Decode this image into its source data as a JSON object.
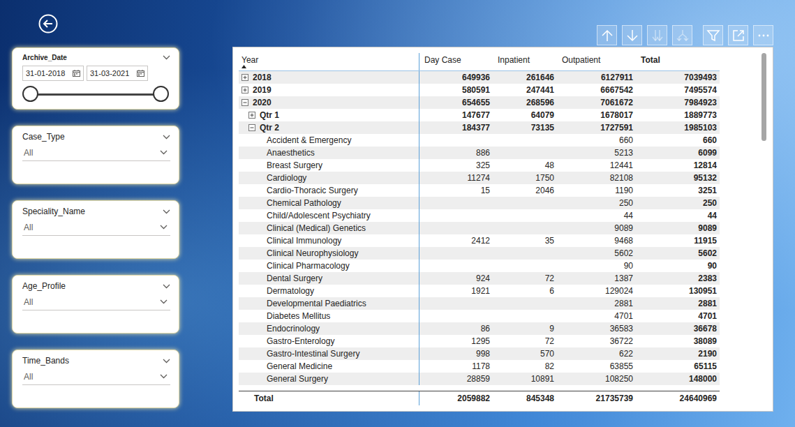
{
  "slicers": [
    {
      "kind": "date-range",
      "title": "Archive_Date",
      "start": "31-01-2018",
      "end": "31-03-2021",
      "low_level": 0,
      "high_level": 1
    },
    {
      "kind": "dropdown",
      "title": "Case_Type",
      "value": "All"
    },
    {
      "kind": "dropdown",
      "title": "Speciality_Name",
      "value": "All"
    },
    {
      "kind": "dropdown",
      "title": "Age_Profile",
      "value": "All"
    },
    {
      "kind": "dropdown",
      "title": "Time_Bands",
      "value": "All"
    }
  ],
  "toolbar": {
    "buttons": [
      {
        "kind": "drill-up",
        "disabled": false
      },
      {
        "kind": "drill-down",
        "disabled": false
      },
      {
        "kind": "next-level",
        "disabled": true
      },
      {
        "kind": "expand-all",
        "disabled": true
      },
      {
        "kind": "filter",
        "disabled": false
      },
      {
        "kind": "focus",
        "disabled": false
      },
      {
        "kind": "more",
        "disabled": false
      }
    ]
  },
  "table": {
    "columns": [
      {
        "label": "Year",
        "sorted": true,
        "bold": false
      },
      {
        "label": "Day Case",
        "sorted": false,
        "bold": false
      },
      {
        "label": "Inpatient",
        "sorted": false,
        "bold": false
      },
      {
        "label": "Outpatient",
        "sorted": false,
        "bold": false
      },
      {
        "label": "Total",
        "sorted": false,
        "bold": true
      }
    ],
    "rows": [
      {
        "kind": "year",
        "label": "2018",
        "expanded": false,
        "values": [
          "649936",
          "261646",
          "6127911",
          "7039493"
        ]
      },
      {
        "kind": "year",
        "label": "2019",
        "expanded": false,
        "values": [
          "580591",
          "247441",
          "6667542",
          "7495574"
        ]
      },
      {
        "kind": "year",
        "label": "2020",
        "expanded": true,
        "values": [
          "654655",
          "268596",
          "7061672",
          "7984923"
        ]
      },
      {
        "kind": "quarter",
        "label": "Qtr 1",
        "expanded": false,
        "values": [
          "147677",
          "64079",
          "1678017",
          "1889773"
        ]
      },
      {
        "kind": "quarter",
        "label": "Qtr 2",
        "expanded": true,
        "values": [
          "184377",
          "73135",
          "1727591",
          "1985103"
        ]
      },
      {
        "kind": "item",
        "label": "Accident & Emergency",
        "expanded": false,
        "values": [
          "",
          "",
          "660",
          "660"
        ]
      },
      {
        "kind": "item",
        "label": "Anaesthetics",
        "expanded": false,
        "values": [
          "886",
          "",
          "5213",
          "6099"
        ]
      },
      {
        "kind": "item",
        "label": "Breast Surgery",
        "expanded": false,
        "values": [
          "325",
          "48",
          "12441",
          "12814"
        ]
      },
      {
        "kind": "item",
        "label": "Cardiology",
        "expanded": false,
        "values": [
          "11274",
          "1750",
          "82108",
          "95132"
        ]
      },
      {
        "kind": "item",
        "label": "Cardio-Thoracic Surgery",
        "expanded": false,
        "values": [
          "15",
          "2046",
          "1190",
          "3251"
        ]
      },
      {
        "kind": "item",
        "label": "Chemical Pathology",
        "expanded": false,
        "values": [
          "",
          "",
          "250",
          "250"
        ]
      },
      {
        "kind": "item",
        "label": "Child/Adolescent Psychiatry",
        "expanded": false,
        "values": [
          "",
          "",
          "44",
          "44"
        ]
      },
      {
        "kind": "item",
        "label": "Clinical (Medical) Genetics",
        "expanded": false,
        "values": [
          "",
          "",
          "9089",
          "9089"
        ]
      },
      {
        "kind": "item",
        "label": "Clinical Immunology",
        "expanded": false,
        "values": [
          "2412",
          "35",
          "9468",
          "11915"
        ]
      },
      {
        "kind": "item",
        "label": "Clinical Neurophysiology",
        "expanded": false,
        "values": [
          "",
          "",
          "5602",
          "5602"
        ]
      },
      {
        "kind": "item",
        "label": "Clinical Pharmacology",
        "expanded": false,
        "values": [
          "",
          "",
          "90",
          "90"
        ]
      },
      {
        "kind": "item",
        "label": "Dental Surgery",
        "expanded": false,
        "values": [
          "924",
          "72",
          "1387",
          "2383"
        ]
      },
      {
        "kind": "item",
        "label": "Dermatology",
        "expanded": false,
        "values": [
          "1921",
          "6",
          "129024",
          "130951"
        ]
      },
      {
        "kind": "item",
        "label": "Developmental Paediatrics",
        "expanded": false,
        "values": [
          "",
          "",
          "2881",
          "2881"
        ]
      },
      {
        "kind": "item",
        "label": "Diabetes Mellitus",
        "expanded": false,
        "values": [
          "",
          "",
          "4701",
          "4701"
        ]
      },
      {
        "kind": "item",
        "label": "Endocrinology",
        "expanded": false,
        "values": [
          "86",
          "9",
          "36583",
          "36678"
        ]
      },
      {
        "kind": "item",
        "label": "Gastro-Enterology",
        "expanded": false,
        "values": [
          "1295",
          "72",
          "36722",
          "38089"
        ]
      },
      {
        "kind": "item",
        "label": "Gastro-Intestinal Surgery",
        "expanded": false,
        "values": [
          "998",
          "570",
          "622",
          "2190"
        ]
      },
      {
        "kind": "item",
        "label": "General Medicine",
        "expanded": false,
        "values": [
          "1178",
          "82",
          "63855",
          "65115"
        ]
      },
      {
        "kind": "item",
        "label": "General Surgery",
        "expanded": false,
        "values": [
          "28859",
          "10891",
          "108250",
          "148000"
        ]
      }
    ],
    "total": {
      "label": "Total",
      "values": [
        "2059882",
        "845348",
        "21735739",
        "24640969"
      ]
    },
    "scrollbar": {
      "level": 0.25
    }
  }
}
